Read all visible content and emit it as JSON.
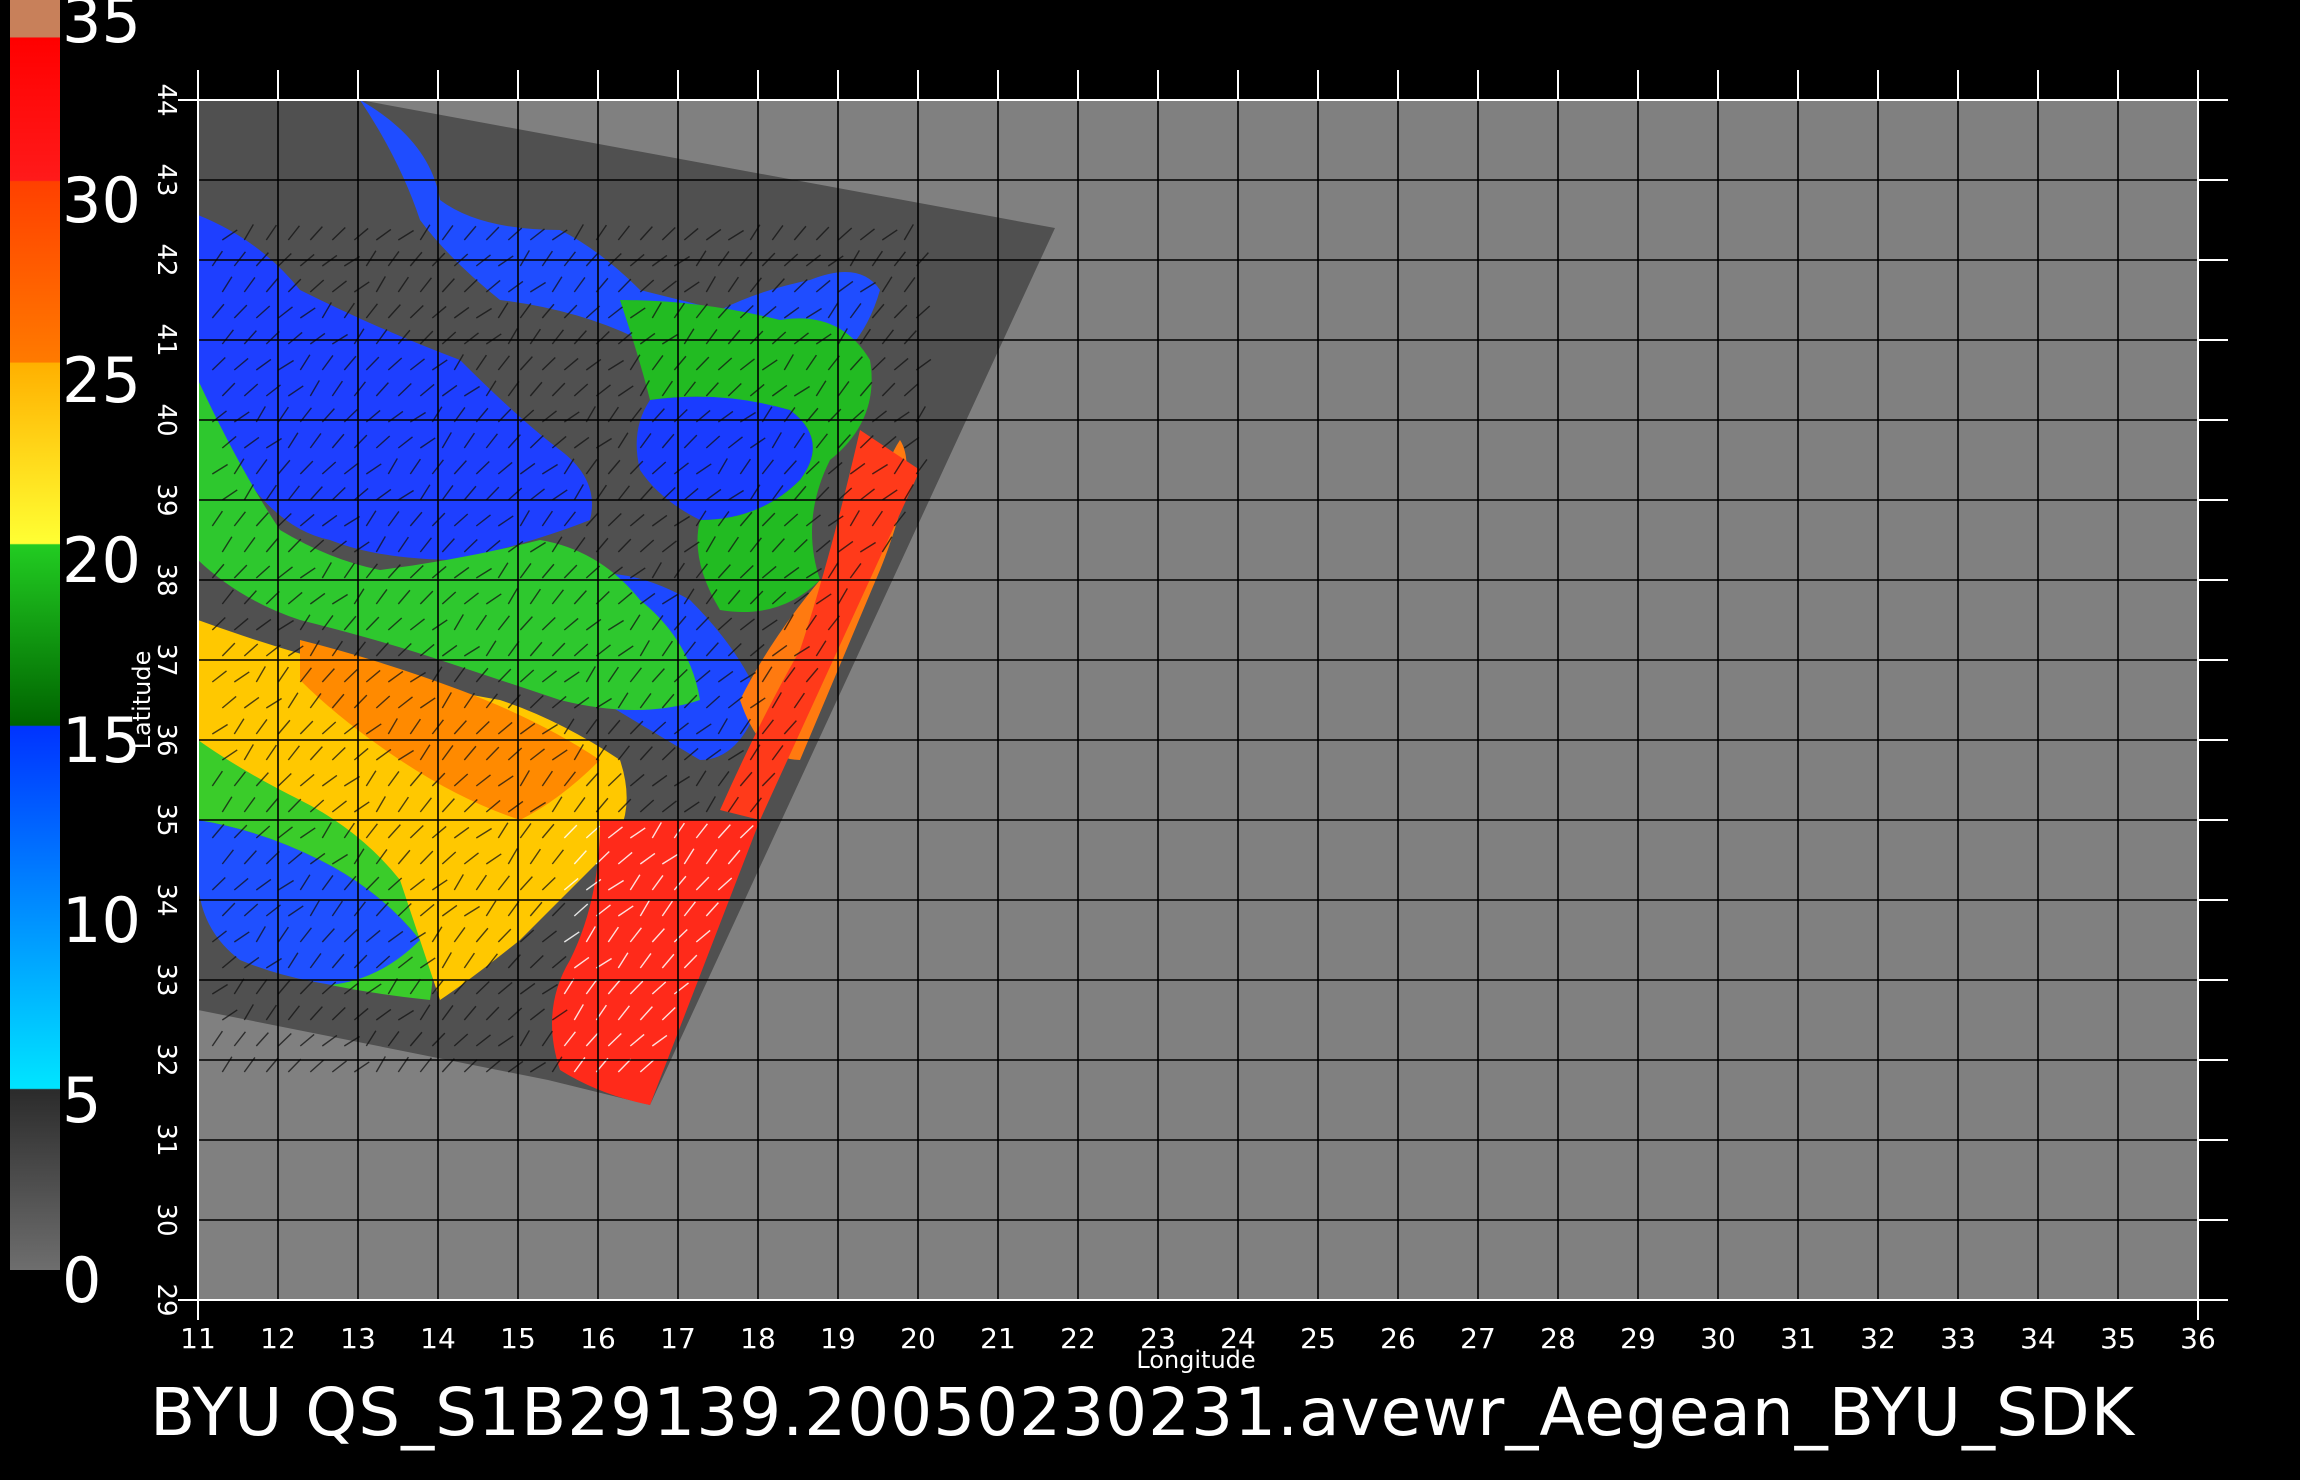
{
  "colorbar": {
    "labels": [
      "35",
      "30",
      "25",
      "20",
      "15",
      "10",
      "5",
      "0"
    ],
    "stops": [
      {
        "value": 0,
        "color": "#6e6e6e"
      },
      {
        "value": 5,
        "color": "#2b2b2b"
      },
      {
        "value": 5.01,
        "color": "#00e5ff"
      },
      {
        "value": 15,
        "color": "#0033ff"
      },
      {
        "value": 15.01,
        "color": "#006400"
      },
      {
        "value": 20,
        "color": "#22cc22"
      },
      {
        "value": 20.01,
        "color": "#ffff33"
      },
      {
        "value": 25,
        "color": "#ffb000"
      },
      {
        "value": 25.01,
        "color": "#ff7a00"
      },
      {
        "value": 30,
        "color": "#ff4000"
      },
      {
        "value": 30.01,
        "color": "#ff1a1a"
      },
      {
        "value": 34,
        "color": "#ff0000"
      },
      {
        "value": 34.01,
        "color": "#c8805a"
      },
      {
        "value": 35,
        "color": "#c8805a"
      }
    ]
  },
  "axes": {
    "lon_ticks": [
      "11",
      "12",
      "13",
      "14",
      "15",
      "16",
      "17",
      "18",
      "19",
      "20",
      "21",
      "22",
      "23",
      "24",
      "25",
      "26",
      "27",
      "28",
      "29",
      "30",
      "31",
      "32",
      "33",
      "34",
      "35",
      "36"
    ],
    "lat_ticks": [
      "29",
      "30",
      "31",
      "32",
      "33",
      "34",
      "35",
      "36",
      "37",
      "38",
      "39",
      "40",
      "41",
      "42",
      "43",
      "44"
    ],
    "xlabel": "Longitude",
    "ylabel": "Latitude"
  },
  "caption": "BYU  QS_S1B29139.20050230231.avewr_Aegean_BYU_SDK",
  "colors": {
    "background": "#000000",
    "plot_fill": "#808080",
    "swath_fill": "#505050",
    "grid": "#000000"
  }
}
